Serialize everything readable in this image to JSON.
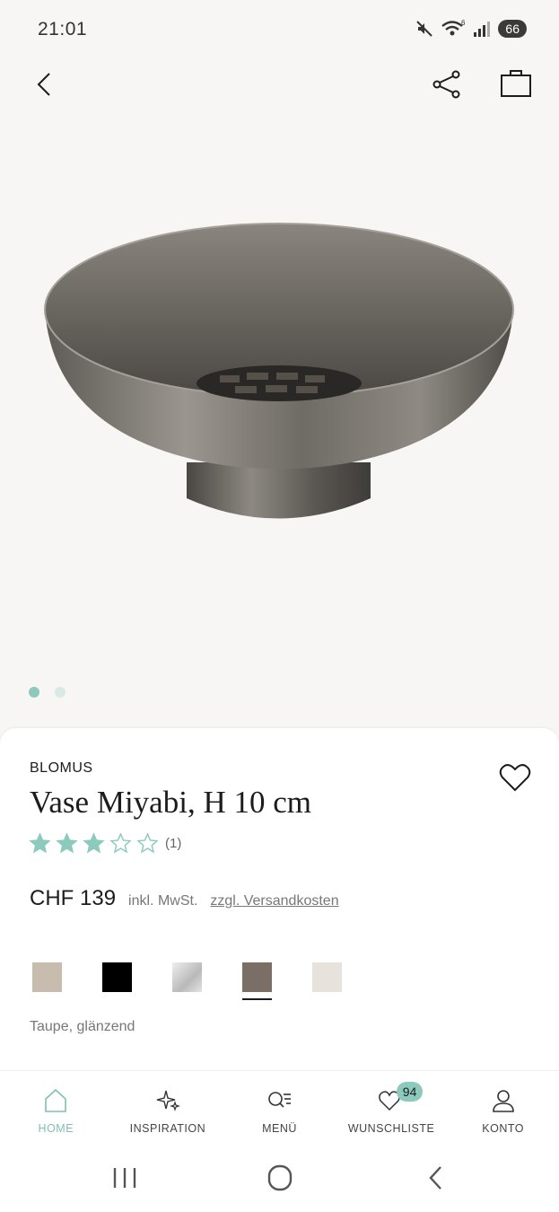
{
  "status_bar": {
    "time": "21:01",
    "battery": "66"
  },
  "product": {
    "brand": "BLOMUS",
    "title": "Vase Miyabi, H 10 cm",
    "rating": 3,
    "rating_max": 5,
    "rating_count": "(1)",
    "price": "CHF 139",
    "vat_note": "inkl. MwSt.",
    "shipping_link": "zzgl. Versandkosten",
    "image_count": 2,
    "active_image": 0,
    "swatches": [
      {
        "color": "#c8bcae",
        "selected": false
      },
      {
        "color": "#000000",
        "selected": false
      },
      {
        "color": "#cfcfcf",
        "selected": false
      },
      {
        "color": "#7a6e66",
        "selected": true
      },
      {
        "color": "#e8e2dc",
        "selected": false
      }
    ],
    "selected_color_name": "Taupe, glänzend"
  },
  "bottom_nav": {
    "items": [
      {
        "label": "HOME",
        "icon": "home-icon",
        "active": true
      },
      {
        "label": "INSPIRATION",
        "icon": "sparkle-icon",
        "active": false
      },
      {
        "label": "MENÜ",
        "icon": "menu-search-icon",
        "active": false
      },
      {
        "label": "WUNSCHLISTE",
        "icon": "heart-icon",
        "active": false,
        "badge": "94"
      },
      {
        "label": "KONTO",
        "icon": "user-icon",
        "active": false
      }
    ]
  },
  "colors": {
    "accent": "#8fc8bc",
    "star": "#8ccabd"
  }
}
